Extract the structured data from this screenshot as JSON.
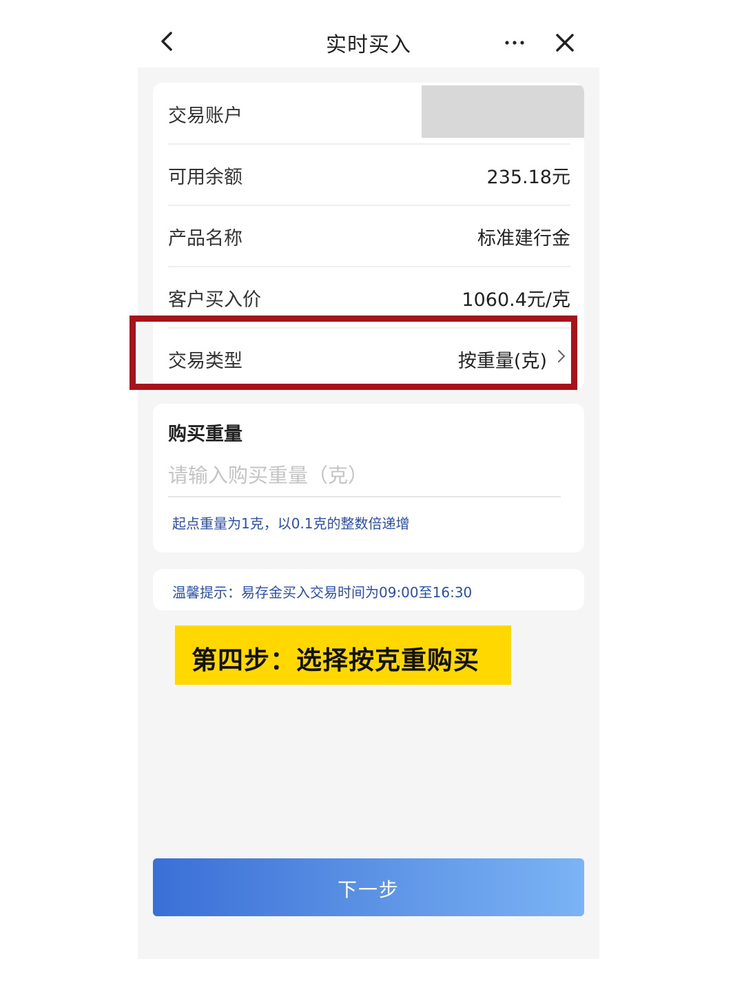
{
  "header": {
    "title": "实时买入",
    "back_icon": "chevron-left-icon",
    "more_icon": "more-dots-icon",
    "close_icon": "close-icon"
  },
  "info": {
    "account_label": "交易账户",
    "balance_label": "可用余额",
    "balance_value": "235.18元",
    "product_label": "产品名称",
    "product_value": "标准建行金",
    "price_label": "客户买入价",
    "price_value": "1060.4元/克",
    "type_label": "交易类型",
    "type_value": "按重量(克)"
  },
  "weight": {
    "title": "购买重量",
    "placeholder": "请输入购买重量（克）",
    "value": "",
    "hint": "起点重量为1克，以0.1克的整数倍递增"
  },
  "tip": {
    "text": "温馨提示：易存金买入交易时间为09:00至16:30"
  },
  "annotation": {
    "step_text": "第四步：选择按克重购买",
    "highlight_color": "#a8131b",
    "banner_color": "#ffd800"
  },
  "footer": {
    "next_label": "下一步"
  }
}
